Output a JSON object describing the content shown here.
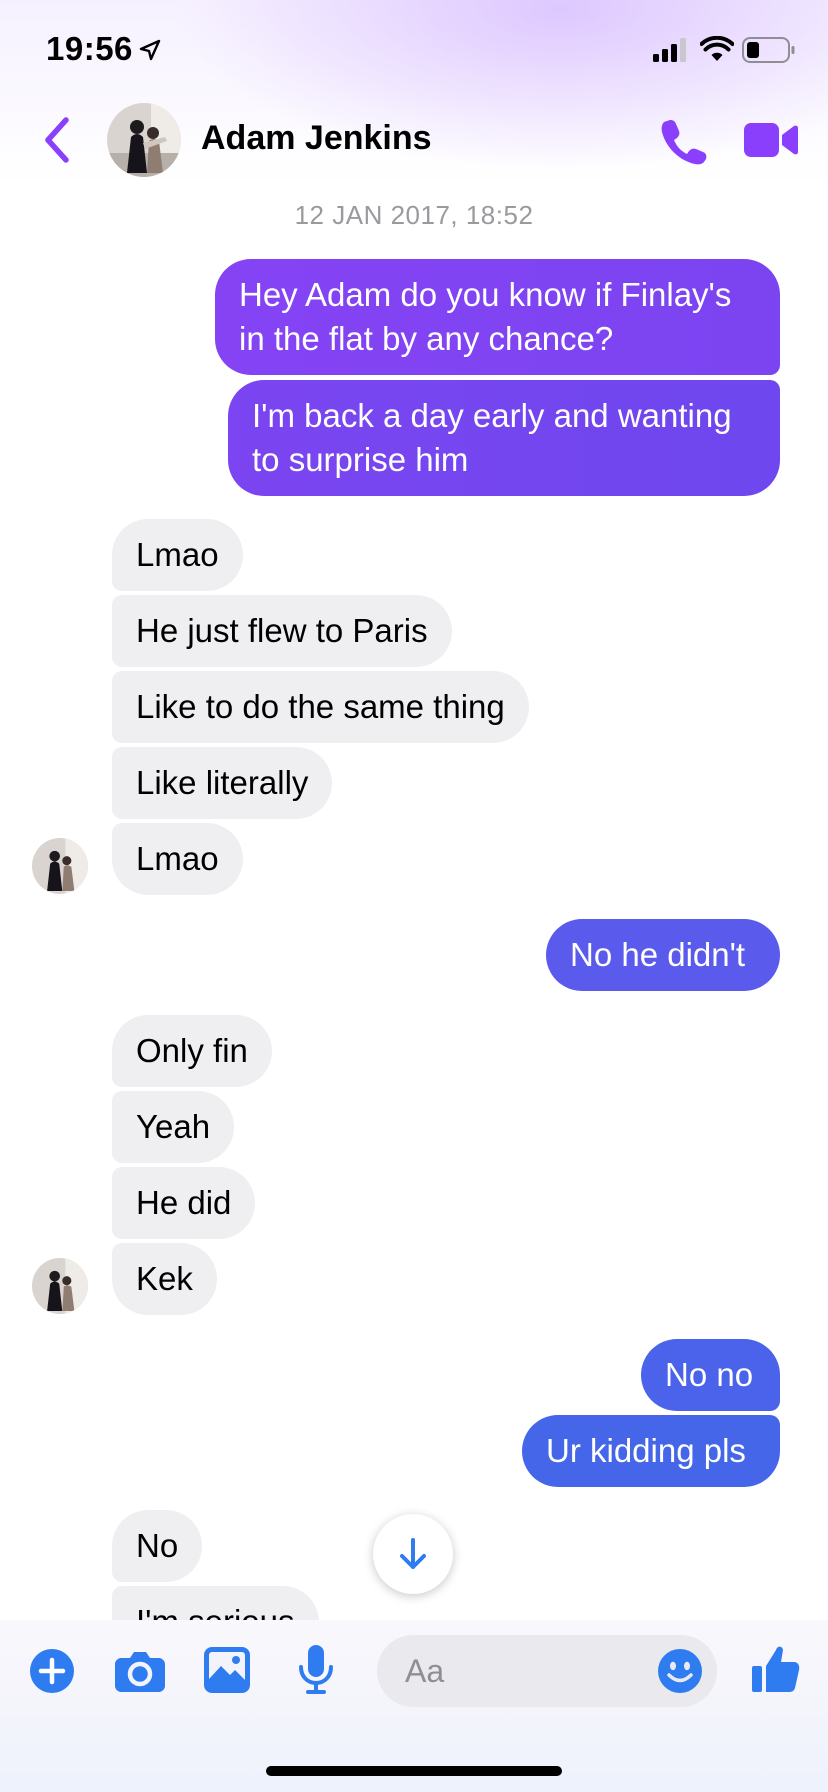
{
  "status_bar": {
    "time": "19:56"
  },
  "header": {
    "contact_name": "Adam Jenkins"
  },
  "conversation": {
    "timestamp": "12 JAN 2017, 18:52",
    "messages": [
      {
        "from": "me",
        "text": "Hey Adam do you know if Finlay's in the flat by any chance?"
      },
      {
        "from": "me",
        "text": "I'm back a day early and wanting to surprise him"
      },
      {
        "from": "them",
        "text": "Lmao"
      },
      {
        "from": "them",
        "text": "He just flew to Paris"
      },
      {
        "from": "them",
        "text": "Like to do the same thing"
      },
      {
        "from": "them",
        "text": "Like literally"
      },
      {
        "from": "them",
        "text": "Lmao"
      },
      {
        "from": "me",
        "text": "No he didn't"
      },
      {
        "from": "them",
        "text": "Only fin"
      },
      {
        "from": "them",
        "text": "Yeah"
      },
      {
        "from": "them",
        "text": "He did"
      },
      {
        "from": "them",
        "text": "Kek"
      },
      {
        "from": "me",
        "text": "No no"
      },
      {
        "from": "me",
        "text": "Ur kidding pls"
      },
      {
        "from": "them",
        "text": "No"
      },
      {
        "from": "them",
        "text": "I'm serious"
      }
    ]
  },
  "composer": {
    "placeholder": "Aa"
  },
  "icons": {
    "back": "chevron-left-icon",
    "phone": "phone-icon",
    "video": "video-camera-icon",
    "scroll": "arrow-down-icon",
    "plus": "plus-circle-icon",
    "camera": "camera-icon",
    "gallery": "image-icon",
    "mic": "microphone-icon",
    "emoji": "smiley-icon",
    "like": "thumbs-up-icon"
  },
  "colors": {
    "accent_purple": "#8a3ffc",
    "outgoing_violet": "#7a43f0",
    "outgoing_blue": "#4a63ea",
    "incoming_gray": "#efeff1",
    "icon_blue": "#2f7cf0"
  }
}
